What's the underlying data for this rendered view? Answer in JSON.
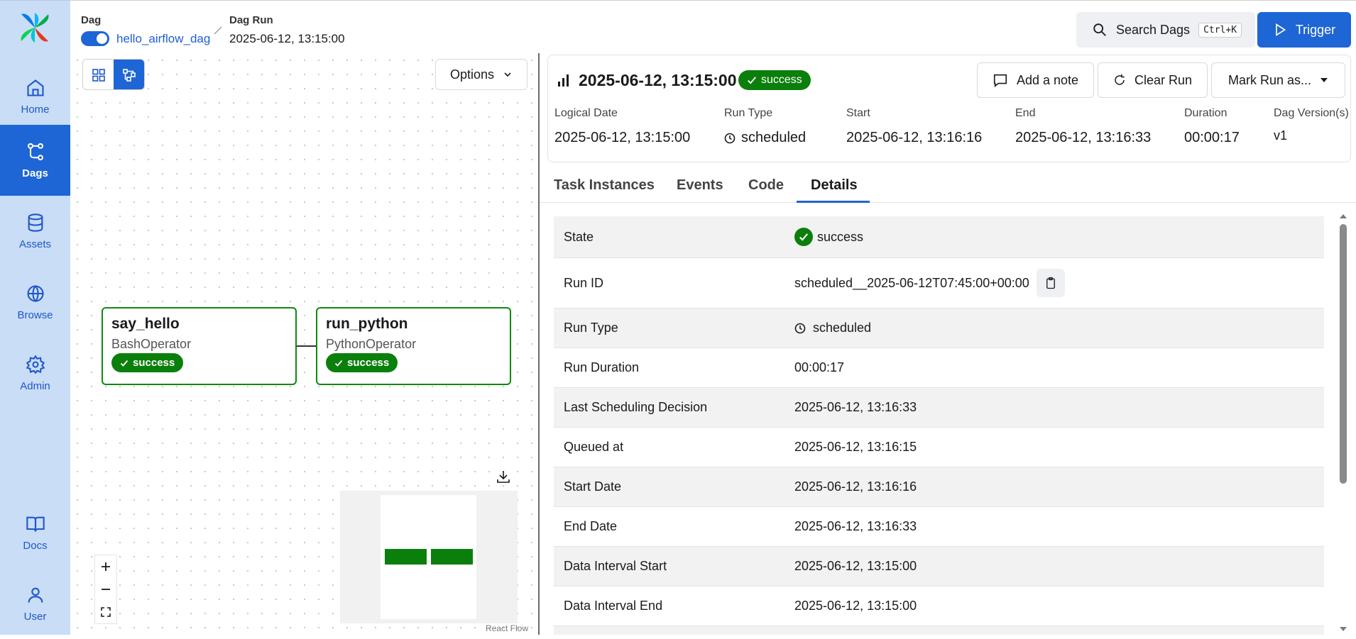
{
  "sidebar": {
    "items": [
      {
        "label": "Home",
        "icon": "home-icon"
      },
      {
        "label": "Dags",
        "icon": "dags-icon"
      },
      {
        "label": "Assets",
        "icon": "database-icon"
      },
      {
        "label": "Browse",
        "icon": "globe-icon"
      },
      {
        "label": "Admin",
        "icon": "gear-icon"
      },
      {
        "label": "Docs",
        "icon": "book-icon"
      },
      {
        "label": "User",
        "icon": "user-icon"
      }
    ],
    "active": "Dags"
  },
  "breadcrumb": {
    "dag_label": "Dag",
    "dag_name": "hello_airflow_dag",
    "run_label": "Dag Run",
    "run_name": "2025-06-12, 13:15:00",
    "dag_paused": false
  },
  "header": {
    "search_label": "Search Dags",
    "search_shortcut": "Ctrl+K",
    "trigger_label": "Trigger"
  },
  "graph": {
    "options_label": "Options",
    "nodes": [
      {
        "name": "say_hello",
        "operator": "BashOperator",
        "state": "success"
      },
      {
        "name": "run_python",
        "operator": "PythonOperator",
        "state": "success"
      }
    ],
    "attribution": "React Flow"
  },
  "run": {
    "title": "2025-06-12, 13:15:00",
    "state": "success",
    "buttons": {
      "note": "Add a note",
      "clear": "Clear Run",
      "mark": "Mark Run as..."
    },
    "meta": {
      "logical_date_label": "Logical Date",
      "logical_date": "2025-06-12, 13:15:00",
      "run_type_label": "Run Type",
      "run_type": "scheduled",
      "start_label": "Start",
      "start": "2025-06-12, 13:16:16",
      "end_label": "End",
      "end": "2025-06-12, 13:16:33",
      "duration_label": "Duration",
      "duration": "00:00:17",
      "version_label": "Dag Version(s)",
      "version": "v1"
    }
  },
  "tabs": [
    "Task Instances",
    "Events",
    "Code",
    "Details"
  ],
  "active_tab": "Details",
  "details": [
    {
      "key": "State",
      "value": "success"
    },
    {
      "key": "Run ID",
      "value": "scheduled__2025-06-12T07:45:00+00:00"
    },
    {
      "key": "Run Type",
      "value": "scheduled"
    },
    {
      "key": "Run Duration",
      "value": "00:00:17"
    },
    {
      "key": "Last Scheduling Decision",
      "value": "2025-06-12, 13:16:33"
    },
    {
      "key": "Queued at",
      "value": "2025-06-12, 13:16:15"
    },
    {
      "key": "Start Date",
      "value": "2025-06-12, 13:16:16"
    },
    {
      "key": "End Date",
      "value": "2025-06-12, 13:16:33"
    },
    {
      "key": "Data Interval Start",
      "value": "2025-06-12, 13:15:00"
    },
    {
      "key": "Data Interval End",
      "value": "2025-06-12, 13:15:00"
    }
  ],
  "colors": {
    "accent": "#1e65d6",
    "success": "#0b7f0b",
    "sidebar": "#c9ddf7"
  }
}
